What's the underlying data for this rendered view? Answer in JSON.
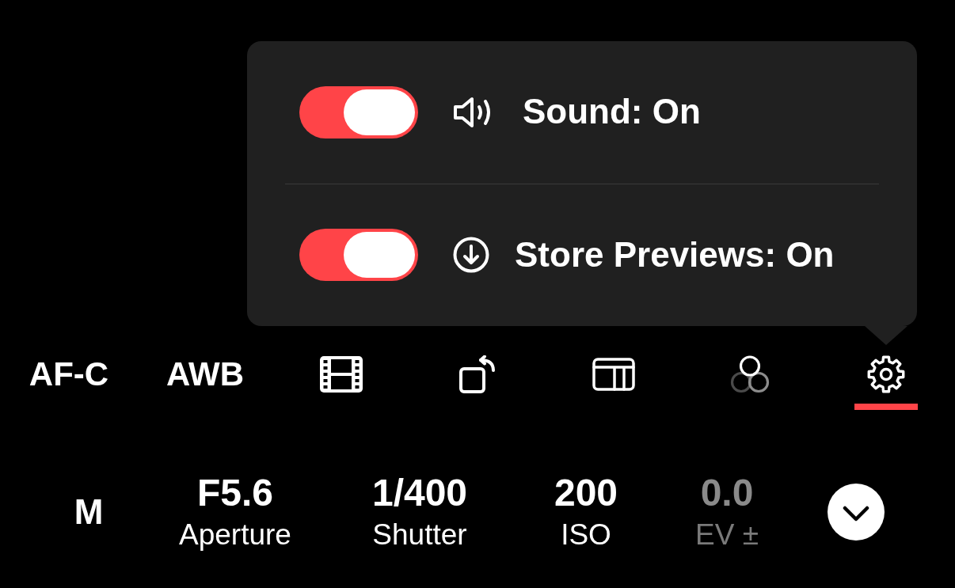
{
  "settings_popover": {
    "items": [
      {
        "label": "Sound: On",
        "on": true
      },
      {
        "label": "Store Previews: On",
        "on": true
      }
    ]
  },
  "toolbar": {
    "items": [
      {
        "kind": "text",
        "label": "AF-C",
        "selected": false
      },
      {
        "kind": "text",
        "label": "AWB",
        "selected": false
      },
      {
        "kind": "icon",
        "selected": false
      },
      {
        "kind": "icon",
        "selected": false
      },
      {
        "kind": "icon",
        "selected": false
      },
      {
        "kind": "icon",
        "selected": false
      },
      {
        "kind": "icon",
        "selected": true
      }
    ]
  },
  "exposure": {
    "mode": "M",
    "controls": [
      {
        "value": "F5.6",
        "label": "Aperture",
        "disabled": false
      },
      {
        "value": "1/400",
        "label": "Shutter",
        "disabled": false
      },
      {
        "value": "200",
        "label": "ISO",
        "disabled": false
      },
      {
        "value": "0.0",
        "label": "EV ±",
        "disabled": true
      }
    ]
  }
}
